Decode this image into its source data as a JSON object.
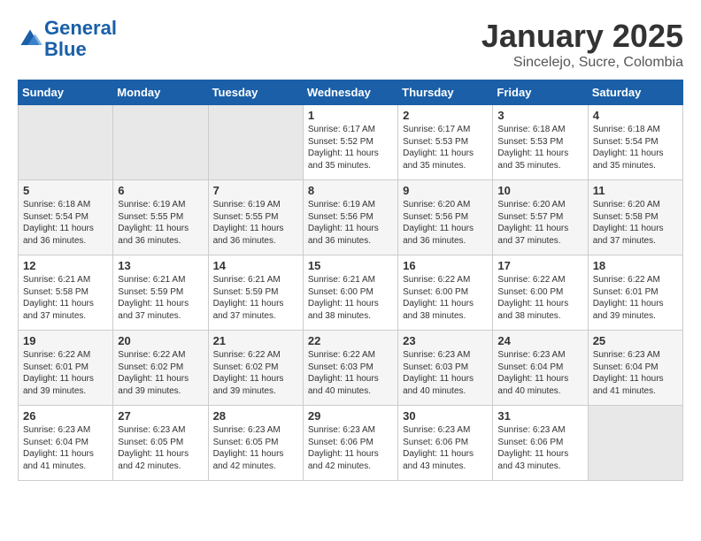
{
  "header": {
    "logo_line1": "General",
    "logo_line2": "Blue",
    "month": "January 2025",
    "location": "Sincelejo, Sucre, Colombia"
  },
  "weekdays": [
    "Sunday",
    "Monday",
    "Tuesday",
    "Wednesday",
    "Thursday",
    "Friday",
    "Saturday"
  ],
  "weeks": [
    [
      {
        "day": "",
        "info": ""
      },
      {
        "day": "",
        "info": ""
      },
      {
        "day": "",
        "info": ""
      },
      {
        "day": "1",
        "info": "Sunrise: 6:17 AM\nSunset: 5:52 PM\nDaylight: 11 hours\nand 35 minutes."
      },
      {
        "day": "2",
        "info": "Sunrise: 6:17 AM\nSunset: 5:53 PM\nDaylight: 11 hours\nand 35 minutes."
      },
      {
        "day": "3",
        "info": "Sunrise: 6:18 AM\nSunset: 5:53 PM\nDaylight: 11 hours\nand 35 minutes."
      },
      {
        "day": "4",
        "info": "Sunrise: 6:18 AM\nSunset: 5:54 PM\nDaylight: 11 hours\nand 35 minutes."
      }
    ],
    [
      {
        "day": "5",
        "info": "Sunrise: 6:18 AM\nSunset: 5:54 PM\nDaylight: 11 hours\nand 36 minutes."
      },
      {
        "day": "6",
        "info": "Sunrise: 6:19 AM\nSunset: 5:55 PM\nDaylight: 11 hours\nand 36 minutes."
      },
      {
        "day": "7",
        "info": "Sunrise: 6:19 AM\nSunset: 5:55 PM\nDaylight: 11 hours\nand 36 minutes."
      },
      {
        "day": "8",
        "info": "Sunrise: 6:19 AM\nSunset: 5:56 PM\nDaylight: 11 hours\nand 36 minutes."
      },
      {
        "day": "9",
        "info": "Sunrise: 6:20 AM\nSunset: 5:56 PM\nDaylight: 11 hours\nand 36 minutes."
      },
      {
        "day": "10",
        "info": "Sunrise: 6:20 AM\nSunset: 5:57 PM\nDaylight: 11 hours\nand 37 minutes."
      },
      {
        "day": "11",
        "info": "Sunrise: 6:20 AM\nSunset: 5:58 PM\nDaylight: 11 hours\nand 37 minutes."
      }
    ],
    [
      {
        "day": "12",
        "info": "Sunrise: 6:21 AM\nSunset: 5:58 PM\nDaylight: 11 hours\nand 37 minutes."
      },
      {
        "day": "13",
        "info": "Sunrise: 6:21 AM\nSunset: 5:59 PM\nDaylight: 11 hours\nand 37 minutes."
      },
      {
        "day": "14",
        "info": "Sunrise: 6:21 AM\nSunset: 5:59 PM\nDaylight: 11 hours\nand 37 minutes."
      },
      {
        "day": "15",
        "info": "Sunrise: 6:21 AM\nSunset: 6:00 PM\nDaylight: 11 hours\nand 38 minutes."
      },
      {
        "day": "16",
        "info": "Sunrise: 6:22 AM\nSunset: 6:00 PM\nDaylight: 11 hours\nand 38 minutes."
      },
      {
        "day": "17",
        "info": "Sunrise: 6:22 AM\nSunset: 6:00 PM\nDaylight: 11 hours\nand 38 minutes."
      },
      {
        "day": "18",
        "info": "Sunrise: 6:22 AM\nSunset: 6:01 PM\nDaylight: 11 hours\nand 39 minutes."
      }
    ],
    [
      {
        "day": "19",
        "info": "Sunrise: 6:22 AM\nSunset: 6:01 PM\nDaylight: 11 hours\nand 39 minutes."
      },
      {
        "day": "20",
        "info": "Sunrise: 6:22 AM\nSunset: 6:02 PM\nDaylight: 11 hours\nand 39 minutes."
      },
      {
        "day": "21",
        "info": "Sunrise: 6:22 AM\nSunset: 6:02 PM\nDaylight: 11 hours\nand 39 minutes."
      },
      {
        "day": "22",
        "info": "Sunrise: 6:22 AM\nSunset: 6:03 PM\nDaylight: 11 hours\nand 40 minutes."
      },
      {
        "day": "23",
        "info": "Sunrise: 6:23 AM\nSunset: 6:03 PM\nDaylight: 11 hours\nand 40 minutes."
      },
      {
        "day": "24",
        "info": "Sunrise: 6:23 AM\nSunset: 6:04 PM\nDaylight: 11 hours\nand 40 minutes."
      },
      {
        "day": "25",
        "info": "Sunrise: 6:23 AM\nSunset: 6:04 PM\nDaylight: 11 hours\nand 41 minutes."
      }
    ],
    [
      {
        "day": "26",
        "info": "Sunrise: 6:23 AM\nSunset: 6:04 PM\nDaylight: 11 hours\nand 41 minutes."
      },
      {
        "day": "27",
        "info": "Sunrise: 6:23 AM\nSunset: 6:05 PM\nDaylight: 11 hours\nand 42 minutes."
      },
      {
        "day": "28",
        "info": "Sunrise: 6:23 AM\nSunset: 6:05 PM\nDaylight: 11 hours\nand 42 minutes."
      },
      {
        "day": "29",
        "info": "Sunrise: 6:23 AM\nSunset: 6:06 PM\nDaylight: 11 hours\nand 42 minutes."
      },
      {
        "day": "30",
        "info": "Sunrise: 6:23 AM\nSunset: 6:06 PM\nDaylight: 11 hours\nand 43 minutes."
      },
      {
        "day": "31",
        "info": "Sunrise: 6:23 AM\nSunset: 6:06 PM\nDaylight: 11 hours\nand 43 minutes."
      },
      {
        "day": "",
        "info": ""
      }
    ]
  ]
}
